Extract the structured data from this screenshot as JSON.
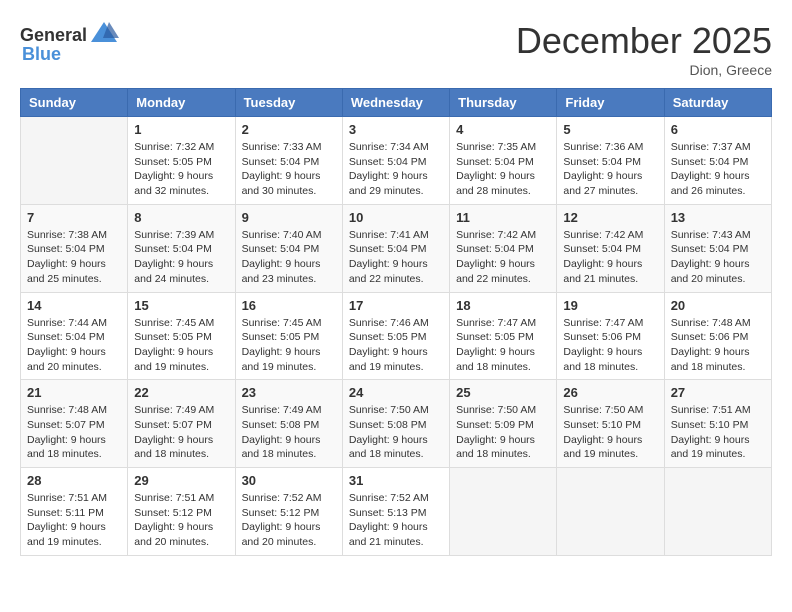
{
  "header": {
    "logo_general": "General",
    "logo_blue": "Blue",
    "month": "December 2025",
    "location": "Dion, Greece"
  },
  "weekdays": [
    "Sunday",
    "Monday",
    "Tuesday",
    "Wednesday",
    "Thursday",
    "Friday",
    "Saturday"
  ],
  "weeks": [
    [
      {
        "day": "",
        "sunrise": "",
        "sunset": "",
        "daylight": ""
      },
      {
        "day": "1",
        "sunrise": "7:32 AM",
        "sunset": "5:05 PM",
        "daylight": "9 hours and 32 minutes."
      },
      {
        "day": "2",
        "sunrise": "7:33 AM",
        "sunset": "5:04 PM",
        "daylight": "9 hours and 30 minutes."
      },
      {
        "day": "3",
        "sunrise": "7:34 AM",
        "sunset": "5:04 PM",
        "daylight": "9 hours and 29 minutes."
      },
      {
        "day": "4",
        "sunrise": "7:35 AM",
        "sunset": "5:04 PM",
        "daylight": "9 hours and 28 minutes."
      },
      {
        "day": "5",
        "sunrise": "7:36 AM",
        "sunset": "5:04 PM",
        "daylight": "9 hours and 27 minutes."
      },
      {
        "day": "6",
        "sunrise": "7:37 AM",
        "sunset": "5:04 PM",
        "daylight": "9 hours and 26 minutes."
      }
    ],
    [
      {
        "day": "7",
        "sunrise": "7:38 AM",
        "sunset": "5:04 PM",
        "daylight": "9 hours and 25 minutes."
      },
      {
        "day": "8",
        "sunrise": "7:39 AM",
        "sunset": "5:04 PM",
        "daylight": "9 hours and 24 minutes."
      },
      {
        "day": "9",
        "sunrise": "7:40 AM",
        "sunset": "5:04 PM",
        "daylight": "9 hours and 23 minutes."
      },
      {
        "day": "10",
        "sunrise": "7:41 AM",
        "sunset": "5:04 PM",
        "daylight": "9 hours and 22 minutes."
      },
      {
        "day": "11",
        "sunrise": "7:42 AM",
        "sunset": "5:04 PM",
        "daylight": "9 hours and 22 minutes."
      },
      {
        "day": "12",
        "sunrise": "7:42 AM",
        "sunset": "5:04 PM",
        "daylight": "9 hours and 21 minutes."
      },
      {
        "day": "13",
        "sunrise": "7:43 AM",
        "sunset": "5:04 PM",
        "daylight": "9 hours and 20 minutes."
      }
    ],
    [
      {
        "day": "14",
        "sunrise": "7:44 AM",
        "sunset": "5:04 PM",
        "daylight": "9 hours and 20 minutes."
      },
      {
        "day": "15",
        "sunrise": "7:45 AM",
        "sunset": "5:05 PM",
        "daylight": "9 hours and 19 minutes."
      },
      {
        "day": "16",
        "sunrise": "7:45 AM",
        "sunset": "5:05 PM",
        "daylight": "9 hours and 19 minutes."
      },
      {
        "day": "17",
        "sunrise": "7:46 AM",
        "sunset": "5:05 PM",
        "daylight": "9 hours and 19 minutes."
      },
      {
        "day": "18",
        "sunrise": "7:47 AM",
        "sunset": "5:05 PM",
        "daylight": "9 hours and 18 minutes."
      },
      {
        "day": "19",
        "sunrise": "7:47 AM",
        "sunset": "5:06 PM",
        "daylight": "9 hours and 18 minutes."
      },
      {
        "day": "20",
        "sunrise": "7:48 AM",
        "sunset": "5:06 PM",
        "daylight": "9 hours and 18 minutes."
      }
    ],
    [
      {
        "day": "21",
        "sunrise": "7:48 AM",
        "sunset": "5:07 PM",
        "daylight": "9 hours and 18 minutes."
      },
      {
        "day": "22",
        "sunrise": "7:49 AM",
        "sunset": "5:07 PM",
        "daylight": "9 hours and 18 minutes."
      },
      {
        "day": "23",
        "sunrise": "7:49 AM",
        "sunset": "5:08 PM",
        "daylight": "9 hours and 18 minutes."
      },
      {
        "day": "24",
        "sunrise": "7:50 AM",
        "sunset": "5:08 PM",
        "daylight": "9 hours and 18 minutes."
      },
      {
        "day": "25",
        "sunrise": "7:50 AM",
        "sunset": "5:09 PM",
        "daylight": "9 hours and 18 minutes."
      },
      {
        "day": "26",
        "sunrise": "7:50 AM",
        "sunset": "5:10 PM",
        "daylight": "9 hours and 19 minutes."
      },
      {
        "day": "27",
        "sunrise": "7:51 AM",
        "sunset": "5:10 PM",
        "daylight": "9 hours and 19 minutes."
      }
    ],
    [
      {
        "day": "28",
        "sunrise": "7:51 AM",
        "sunset": "5:11 PM",
        "daylight": "9 hours and 19 minutes."
      },
      {
        "day": "29",
        "sunrise": "7:51 AM",
        "sunset": "5:12 PM",
        "daylight": "9 hours and 20 minutes."
      },
      {
        "day": "30",
        "sunrise": "7:52 AM",
        "sunset": "5:12 PM",
        "daylight": "9 hours and 20 minutes."
      },
      {
        "day": "31",
        "sunrise": "7:52 AM",
        "sunset": "5:13 PM",
        "daylight": "9 hours and 21 minutes."
      },
      {
        "day": "",
        "sunrise": "",
        "sunset": "",
        "daylight": ""
      },
      {
        "day": "",
        "sunrise": "",
        "sunset": "",
        "daylight": ""
      },
      {
        "day": "",
        "sunrise": "",
        "sunset": "",
        "daylight": ""
      }
    ]
  ]
}
